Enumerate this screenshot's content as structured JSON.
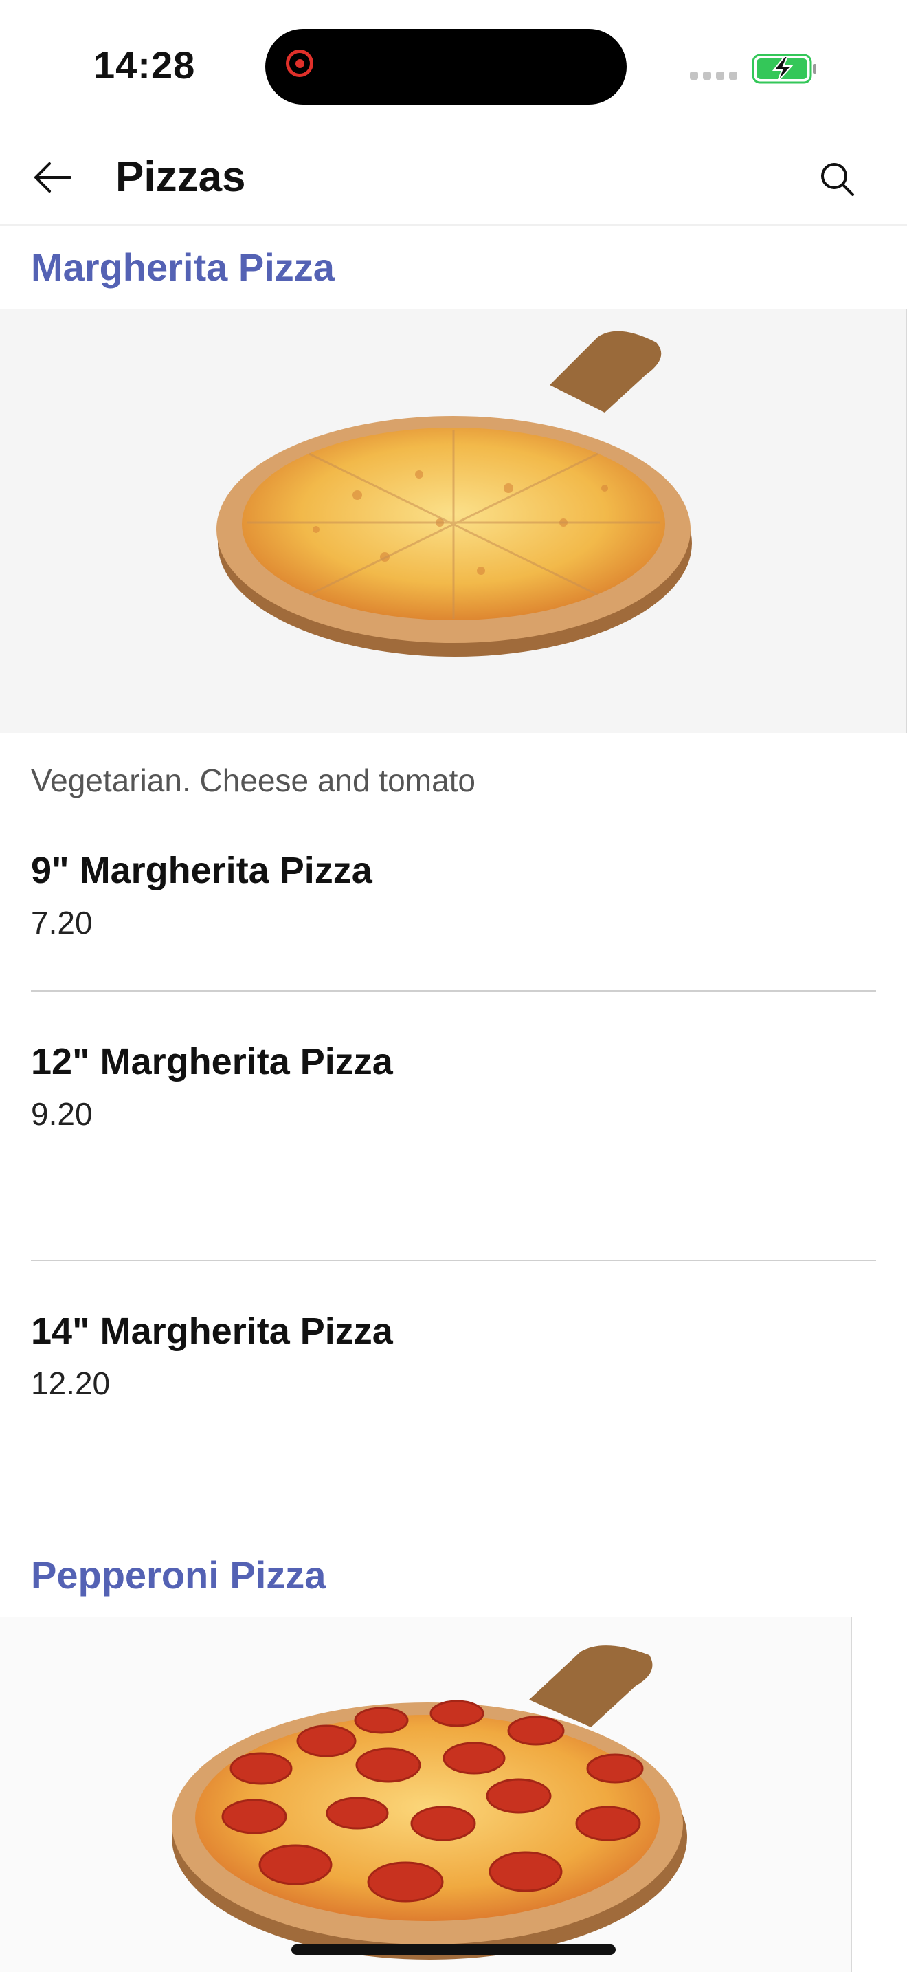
{
  "status_bar": {
    "time": "14:28"
  },
  "app_bar": {
    "title": "Pizzas"
  },
  "sections": [
    {
      "title": "Margherita Pizza",
      "description": "Vegetarian. Cheese and tomato",
      "variants": [
        {
          "name": "9\" Margherita Pizza",
          "price": "7.20"
        },
        {
          "name": "12\" Margherita Pizza",
          "price": "9.20"
        },
        {
          "name": "14\" Margherita Pizza",
          "price": "12.20"
        }
      ]
    },
    {
      "title": "Pepperoni Pizza"
    }
  ],
  "colors": {
    "accent": "#5462b4",
    "battery": "#34c759",
    "recording": "#e0302a"
  },
  "icons": [
    "back-arrow-icon",
    "search-icon",
    "battery-charging-icon",
    "recording-icon"
  ]
}
